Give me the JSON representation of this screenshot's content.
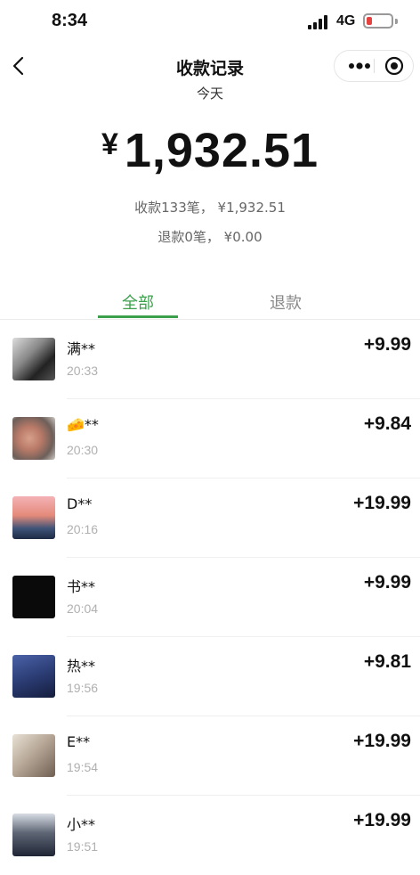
{
  "status_bar": {
    "time": "8:34",
    "network": "4G"
  },
  "nav": {
    "title": "收款记录"
  },
  "summary": {
    "date_label": "今天",
    "currency_symbol": "¥",
    "total": "1,932.51",
    "received_line": "收款133笔， ¥1,932.51",
    "refund_line": "退款0笔， ¥0.00"
  },
  "tabs": [
    {
      "label": "全部",
      "active": true
    },
    {
      "label": "退款",
      "active": false
    }
  ],
  "colors": {
    "accent": "#3b9f4b",
    "battery_low": "#e64340"
  },
  "transactions": [
    {
      "name": "满**",
      "time": "20:33",
      "amount": "+9.99"
    },
    {
      "name": "🧀**",
      "time": "20:30",
      "amount": "+9.84"
    },
    {
      "name": "D**",
      "time": "20:16",
      "amount": "+19.99"
    },
    {
      "name": "书**",
      "time": "20:04",
      "amount": "+9.99"
    },
    {
      "name": "热**",
      "time": "19:56",
      "amount": "+9.81"
    },
    {
      "name": "E**",
      "time": "19:54",
      "amount": "+19.99"
    },
    {
      "name": "小**",
      "time": "19:51",
      "amount": "+19.99"
    }
  ]
}
